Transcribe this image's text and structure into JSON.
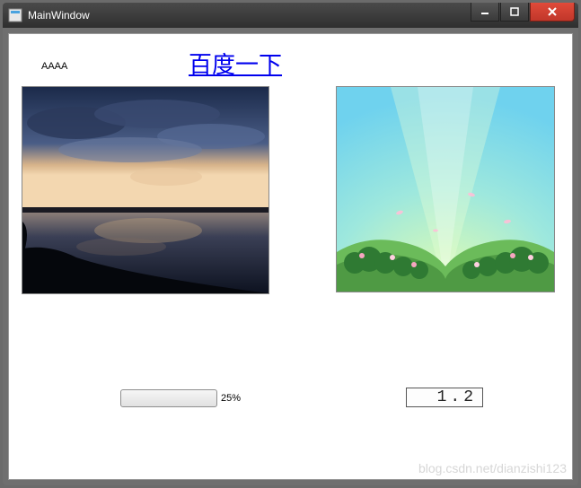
{
  "window": {
    "title": "MainWindow"
  },
  "labels": {
    "small": "AAAA"
  },
  "link": {
    "text": "百度一下"
  },
  "progress": {
    "percent": 25,
    "label": "25%"
  },
  "lcd": {
    "value": "1.2"
  },
  "images": {
    "left_desc": "sunset-photo",
    "right_desc": "cartoon-meadow"
  },
  "watermark": "blog.csdn.net/dianzishi123",
  "colors": {
    "link": "#0000EE",
    "progress_fill": "#2db000",
    "close_btn": "#d7432f"
  }
}
